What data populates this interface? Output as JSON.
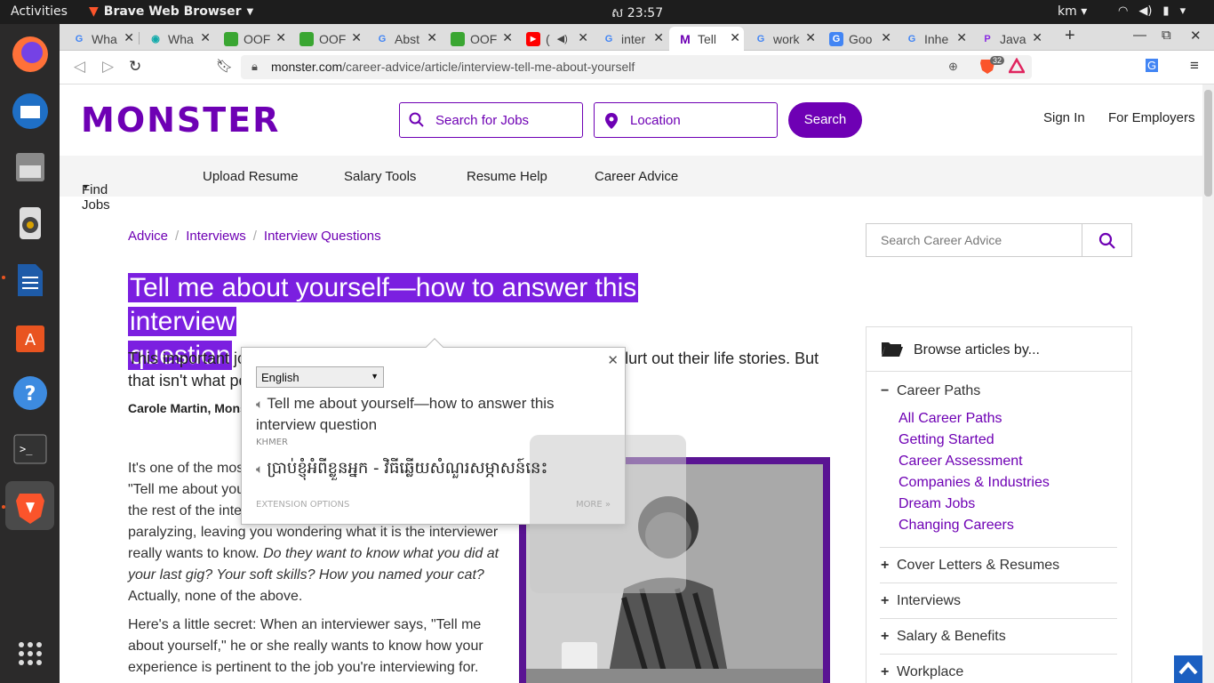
{
  "system": {
    "activities": "Activities",
    "app_name": "Brave Web Browser",
    "clock": "ស 23:57",
    "keyboard_lang": "km"
  },
  "tabs": [
    {
      "label": "Wha",
      "icon": "google-icon"
    },
    {
      "label": "Wha",
      "icon": "eye-icon"
    },
    {
      "label": "OOF",
      "icon": "cube-icon"
    },
    {
      "label": "OOF",
      "icon": "cube-icon"
    },
    {
      "label": "Abst",
      "icon": "google-icon"
    },
    {
      "label": "OOF",
      "icon": "cube-icon"
    },
    {
      "label": "(",
      "icon": "youtube-icon"
    },
    {
      "label": "inter",
      "icon": "google-icon"
    },
    {
      "label": "Tell",
      "icon": "monster-icon"
    },
    {
      "label": "work",
      "icon": "google-icon"
    },
    {
      "label": "Goo",
      "icon": "translate-icon"
    },
    {
      "label": "Inhe",
      "icon": "google-icon"
    },
    {
      "label": "Java",
      "icon": "p-icon"
    }
  ],
  "address": {
    "domain": "monster.com",
    "path": "/career-advice/article/interview-tell-me-about-yourself",
    "shield_count": "32"
  },
  "site": {
    "logo": "MONSTER",
    "search_jobs_placeholder": "Search for Jobs",
    "location_placeholder": "Location",
    "search_button": "Search",
    "sign_in": "Sign In",
    "for_employers": "For Employers",
    "nav": [
      "Find Jobs",
      "Upload Resume",
      "Salary Tools",
      "Resume Help",
      "Career Advice"
    ]
  },
  "breadcrumb": [
    "Advice",
    "Interviews",
    "Interview Questions"
  ],
  "article": {
    "title_line1": "Tell me about yourself—how to answer this interview",
    "title_line2": "question",
    "lede_a": "This important jo",
    "lede_b": "olurt out their life stories. But",
    "lede_c": "that isn't what po",
    "author": "Carole Martin, Monst",
    "p1_a": "It's one of the mos",
    "p1_b": "\"Tell me about you",
    "p1_c": "the rest of the inte",
    "p1_d": "paralyzing, leaving you wondering what it is the interviewer",
    "p1_e": "really wants to know.",
    "p1_e_italic": "Do they want to know what you did at",
    "p1_f_italic": "your last gig? Your soft skills? How you named your cat?",
    "p1_g": "Actually, none of the above.",
    "p2_a": "Here's a little secret: When an interviewer says, \"Tell me",
    "p2_b": "about yourself,\" he or she really wants to know how your",
    "p2_c": "experience is pertinent to the job you're interviewing for."
  },
  "sidebar": {
    "search_placeholder": "Search Career Advice",
    "browse_title": "Browse articles by...",
    "open_category": "Career Paths",
    "sublinks": [
      "All Career Paths",
      "Getting Started",
      "Career Assessment",
      "Companies & Industries",
      "Dream Jobs",
      "Changing Careers"
    ],
    "categories": [
      "Cover Letters & Resumes",
      "Interviews",
      "Salary & Benefits",
      "Workplace"
    ]
  },
  "translate_popup": {
    "language": "English",
    "source_text": "Tell me about yourself—how to answer this interview question",
    "detected_language": "KHMER",
    "translation": "ប្រាប់ខ្ញុំអំពីខ្លួនអ្នក - វិធីឆ្លើយសំណួរសម្ភាសន៍នេះ",
    "extension_options": "EXTENSION OPTIONS",
    "more": "MORE »"
  },
  "colors": {
    "brand_purple": "#6e00b4",
    "selection": "#7b1fe0",
    "to_top": "#1b5fc1"
  }
}
